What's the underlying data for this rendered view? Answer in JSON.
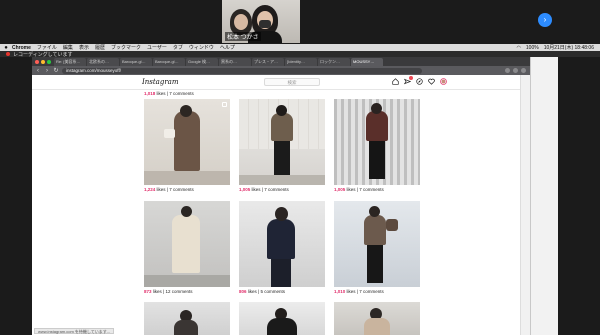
{
  "zoom": {
    "participant_name": "松本 つかさ",
    "side_button_icon": "chevron-right-icon"
  },
  "menubar": {
    "app": "Chrome",
    "items": [
      "ファイル",
      "編集",
      "表示",
      "履歴",
      "ブックマーク",
      "ユーザー",
      "タブ",
      "ウィンドウ",
      "ヘルプ"
    ],
    "battery": "100%",
    "clock": "10月21日(木) 18:48:06"
  },
  "recording": {
    "label": "レコーディングしています"
  },
  "browser": {
    "tabs": [
      "Re: [美容系…",
      "北欧系の…",
      "Baroque-gl…",
      "Baroque-gl…",
      "Google 検…",
      "黒系の…",
      "プレス・ア…",
      "[Identity…",
      "ロックン…",
      "MOUSSY…"
    ],
    "url": "instagram.com/mousseyoff/"
  },
  "instagram": {
    "logo": "Instagram",
    "search_placeholder": "検索",
    "notification_count": "3"
  },
  "posts": [
    {
      "likes": "1,224",
      "comments": "7"
    },
    {
      "likes": "1,005",
      "comments": "7"
    },
    {
      "likes": "1,005",
      "comments": "7"
    },
    {
      "likes": "873",
      "comments": "12"
    },
    {
      "likes": "806",
      "comments": "5"
    },
    {
      "likes": "1,010",
      "comments": "7"
    }
  ],
  "top_row_stats": {
    "likes": "1,018",
    "comments": "7"
  },
  "labels": {
    "likes": "likes",
    "comments": "comments"
  },
  "statusbar": "www.instagram.com を待機しています..."
}
